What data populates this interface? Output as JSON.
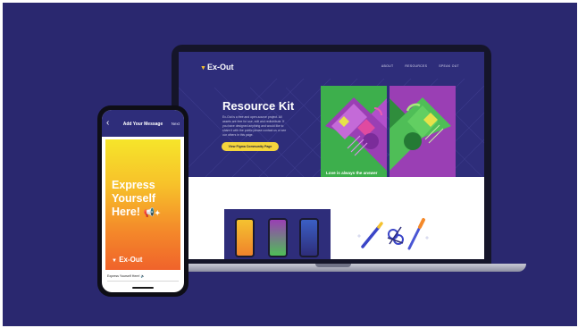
{
  "site": {
    "logo": "Ex-Out",
    "nav": [
      "ABOUT",
      "RESOURCES",
      "SPEAK OUT"
    ],
    "hero_title": "Resource Kit",
    "hero_copy": "Ex-Out is a free and open-source project. All assets are free for use, edit and redistribute. If you have designed anything and would like to share it with the public please contact us or see our others in this page.",
    "cta_label": "View Figma Community Page",
    "poster_text": "Love is always the answer",
    "poster_logo": "Ex-Out"
  },
  "phone": {
    "back_icon": "‹",
    "header_title": "Add Your Message",
    "header_next": "Next",
    "card_text_1": "Express",
    "card_text_2": "Yourself",
    "card_text_3": "Here!",
    "card_logo": "Ex-Out",
    "caption": "Express Yourself Here! 🔈"
  },
  "colors": {
    "background": "#2a286f",
    "site_navy": "#2e2d7a",
    "cta_yellow": "#f5d53c",
    "poster_green": "#3daf4c",
    "poster_purple": "#9a3fb4"
  },
  "icons": [
    "chevron-icon",
    "megaphone-icon",
    "sparkle-icon",
    "back-arrow-icon",
    "pen-icon",
    "scissors-icon",
    "brush-icon"
  ]
}
